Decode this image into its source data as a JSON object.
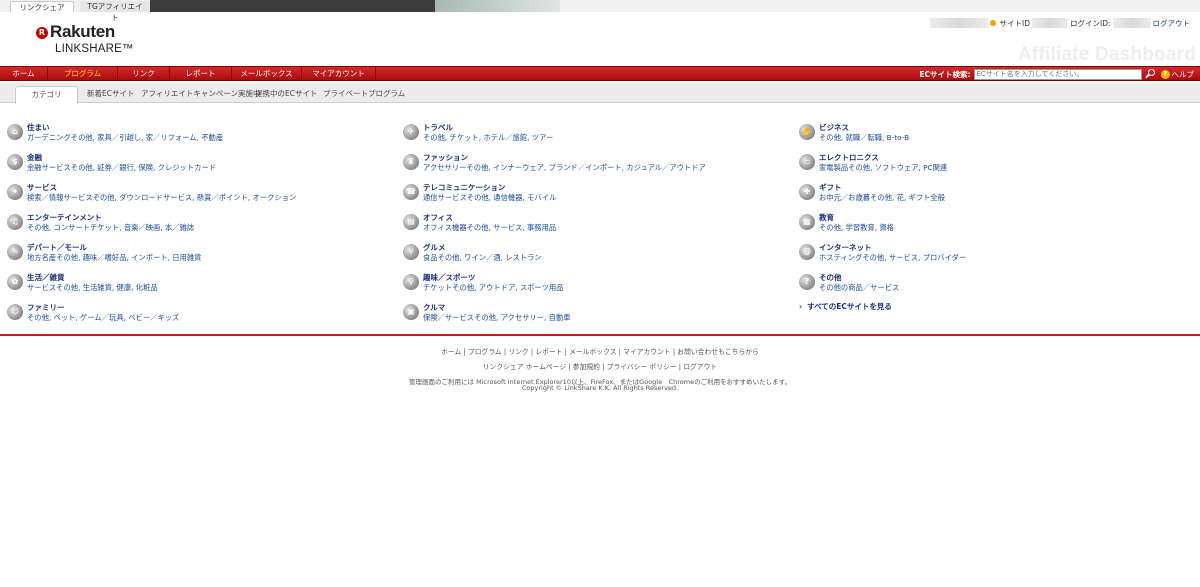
{
  "top_tabs": [
    "リンクシェア",
    "TGアフィリエイト"
  ],
  "brand": {
    "logo_text": "Rakuten",
    "logo_sub": "LINKSHARE",
    "trademark": "™",
    "r_mark": "R"
  },
  "user": {
    "site_id_label": "サイトID",
    "login_id_label": "ログインID:",
    "logout": "ログアウト"
  },
  "watermark": "Affiliate Dashboard",
  "nav": {
    "items": [
      "ホーム",
      "プログラム",
      "リンク",
      "レポート",
      "メールボックス",
      "マイアカウント"
    ],
    "active_index": 1,
    "ec_search_label": "ECサイト検索:",
    "ec_search_placeholder": "ECサイト名を入力してください。",
    "help": "ヘルプ"
  },
  "subtabs": [
    "カテゴリ",
    "新着ECサイト",
    "アフィリエイトキャンペーン実施中",
    "提携中のECサイト",
    "プライベートプログラム"
  ],
  "categories": [
    [
      {
        "title": "住まい",
        "desc": "ガーデニングその他, 家具／引越し, 家／リフォーム, 不動産",
        "icon": "home-icon",
        "glyph": "⌂"
      },
      {
        "title": "金融",
        "desc": "金融サービスその他, 証券／銀行, 保険, クレジットカード",
        "icon": "money-icon",
        "glyph": "$"
      },
      {
        "title": "サービス",
        "desc": "検索／情報サービスその他, ダウンロードサービス, 懸賞／ポイント, オークション",
        "icon": "service-icon",
        "glyph": "✦"
      },
      {
        "title": "エンターテインメント",
        "desc": "その他, コンサートチケット, 音楽／映画, 本／雑誌",
        "icon": "entertainment-icon",
        "glyph": "♫"
      },
      {
        "title": "デパート／モール",
        "desc": "地方名産その他, 趣味／嗜好品, インポート, 日用雑貨",
        "icon": "department-store-icon",
        "glyph": "✎"
      },
      {
        "title": "生活／雑貨",
        "desc": "サービスその他, 生活雑貨, 健康, 化粧品",
        "icon": "lifestyle-icon",
        "glyph": "✿"
      },
      {
        "title": "ファミリー",
        "desc": "その他, ペット, ゲーム／玩具, ベビー／キッズ",
        "icon": "family-icon",
        "glyph": "☺"
      }
    ],
    [
      {
        "title": "トラベル",
        "desc": "その他, チケット, ホテル／旅館, ツアー",
        "icon": "airplane-icon",
        "glyph": "✈"
      },
      {
        "title": "ファッション",
        "desc": "アクセサリーその他, インナーウェア, ブランド／インポート, カジュアル／アウトドア",
        "icon": "shirt-icon",
        "glyph": "♜"
      },
      {
        "title": "テレコミュニケーション",
        "desc": "通信サービスその他, 通信機器, モバイル",
        "icon": "phone-icon",
        "glyph": "☎"
      },
      {
        "title": "オフィス",
        "desc": "オフィス機器その他, サービス, 事務用品",
        "icon": "printer-icon",
        "glyph": "▤"
      },
      {
        "title": "グルメ",
        "desc": "食品その他, ワイン／酒, レストラン",
        "icon": "utensils-icon",
        "glyph": "⑂"
      },
      {
        "title": "趣味／スポーツ",
        "desc": "チケットその他, アウトドア, スポーツ用品",
        "icon": "bicycle-icon",
        "glyph": "⚲"
      },
      {
        "title": "クルマ",
        "desc": "保険／サービスその他, アクセサリー, 自動車",
        "icon": "car-icon",
        "glyph": "▣"
      }
    ],
    [
      {
        "title": "ビジネス",
        "desc": "その他, 就職／転職, B-to-B",
        "icon": "handshake-icon",
        "glyph": "✋"
      },
      {
        "title": "エレクトロニクス",
        "desc": "家電製品その他, ソフトウェア, PC関連",
        "icon": "monitor-icon",
        "glyph": "▭"
      },
      {
        "title": "ギフト",
        "desc": "お中元／お歳暮その他, 花, ギフト全般",
        "icon": "gift-icon",
        "glyph": "✚"
      },
      {
        "title": "教育",
        "desc": "その他, 学習教育, 資格",
        "icon": "education-icon",
        "glyph": "▦"
      },
      {
        "title": "インターネット",
        "desc": "ホスティングその他, サービス, プロバイダー",
        "icon": "internet-icon",
        "glyph": "@"
      },
      {
        "title": "その他",
        "desc": "その他の商品／サービス",
        "icon": "question-icon",
        "glyph": "?"
      }
    ]
  ],
  "view_all": "すべてのECサイトを見る",
  "footer": {
    "line1": "ホーム | プログラム | リンク | レポート | メールボックス | マイアカウント | お問い合わせもこちらから",
    "line2": "リンクシェア ホームページ | 参加規約 | プライバシー ポリシー | ログアウト",
    "line3": "管理画面のご利用には Microsoft Internet Explorer10以上、FireFox、またはGoogle　Chromeのご利用をおすすめいたします。",
    "line4": "Copyright © LinkShare K.K. All Rights Reserved."
  }
}
